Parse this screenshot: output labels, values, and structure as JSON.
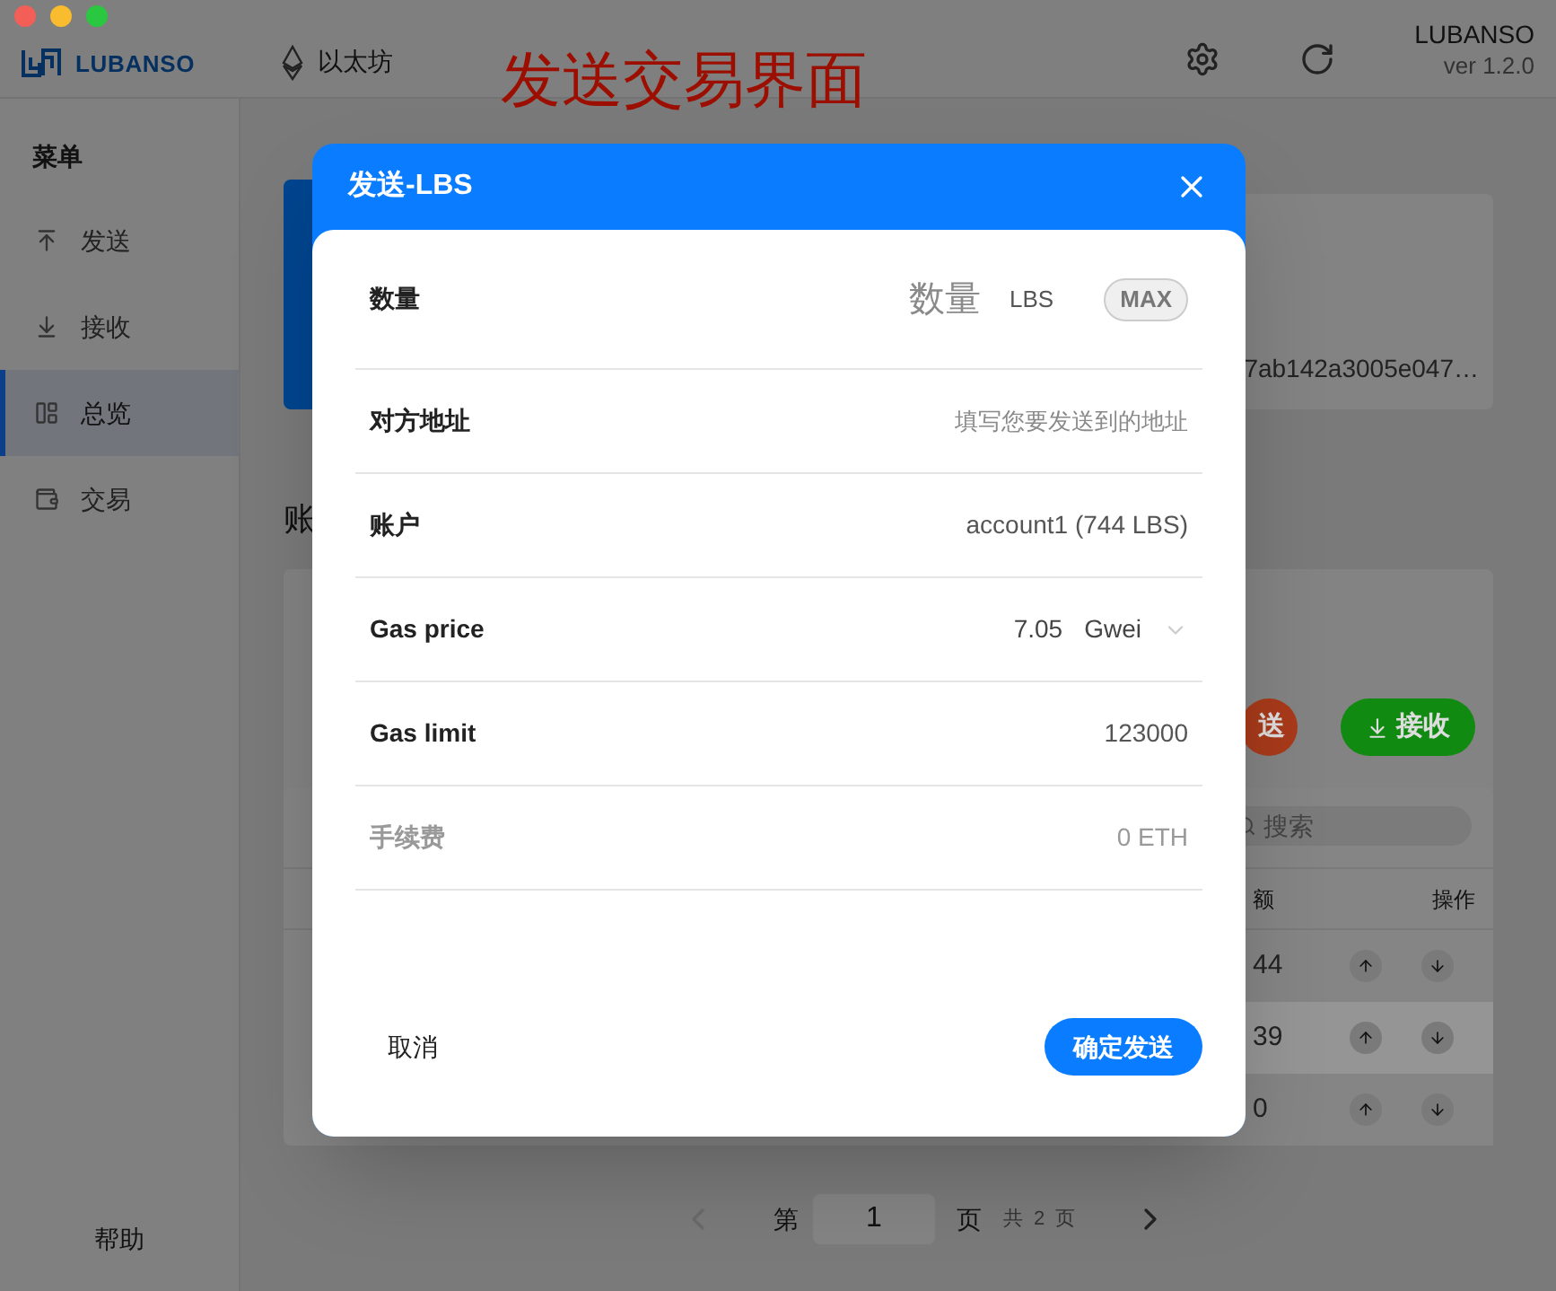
{
  "header": {
    "logo_text": "LUBANSO",
    "network": "以太坊",
    "app_name": "LUBANSO",
    "version": "ver 1.2.0"
  },
  "annotation": "发送交易界面",
  "sidebar": {
    "title": "菜单",
    "items": [
      {
        "label": "发送",
        "selected": false
      },
      {
        "label": "接收",
        "selected": false
      },
      {
        "label": "总览",
        "selected": true
      },
      {
        "label": "交易",
        "selected": false
      }
    ],
    "help": "帮助"
  },
  "account_card": {
    "address": "7ab142a3005e047…"
  },
  "section_heading": "账",
  "actions": [
    {
      "label": "送",
      "kind": "send"
    },
    {
      "label": "接收",
      "kind": "receive"
    }
  ],
  "table": {
    "search_placeholder": "搜索",
    "columns": [
      "额",
      "操作"
    ],
    "rows": [
      {
        "amount": "44",
        "selected": false
      },
      {
        "amount": "39",
        "selected": true
      },
      {
        "amount": "0",
        "selected": false
      }
    ]
  },
  "pagination": {
    "prefix": "第",
    "page": "1",
    "suffix": "页",
    "total_prefix": "共",
    "total": "2",
    "total_suffix": "页"
  },
  "dialog": {
    "title": "发送-LBS",
    "fields": [
      {
        "kind": "amount",
        "label": "数量",
        "placeholder": "数量",
        "unit": "LBS",
        "max_button": "MAX",
        "disabled": false
      },
      {
        "kind": "text",
        "label": "对方地址",
        "placeholder": "填写您要发送到的地址",
        "disabled": false
      },
      {
        "kind": "static",
        "label": "账户",
        "value": "account1 (744 LBS)",
        "disabled": false
      },
      {
        "kind": "select",
        "label": "Gas price",
        "value": "7.05",
        "unit": "Gwei",
        "disabled": false
      },
      {
        "kind": "static",
        "label": "Gas limit",
        "value": "123000",
        "disabled": false
      },
      {
        "kind": "static",
        "label": "手续费",
        "value": "0 ETH",
        "disabled": true
      }
    ],
    "cancel": "取消",
    "confirm": "确定发送"
  }
}
